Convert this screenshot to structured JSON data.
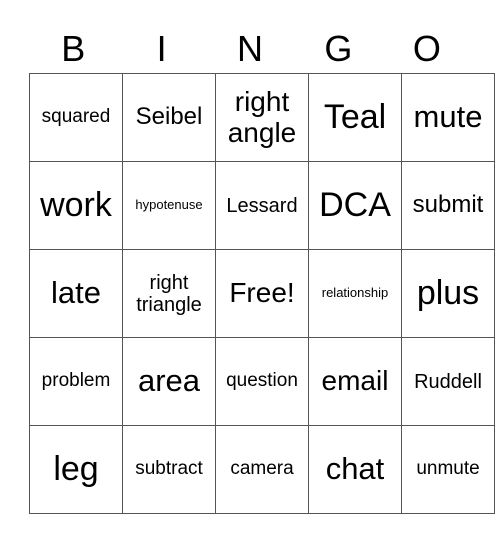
{
  "header": {
    "letters": [
      "B",
      "I",
      "N",
      "G",
      "O"
    ]
  },
  "grid": {
    "rows": [
      [
        "squared",
        "Seibel",
        "right angle",
        "Teal",
        "mute"
      ],
      [
        "work",
        "hypotenuse",
        "Lessard",
        "DCA",
        "submit"
      ],
      [
        "late",
        "right triangle",
        "Free!",
        "relationship",
        "plus"
      ],
      [
        "problem",
        "area",
        "question",
        "email",
        "Ruddell"
      ],
      [
        "leg",
        "subtract",
        "camera",
        "chat",
        "unmute"
      ]
    ]
  }
}
